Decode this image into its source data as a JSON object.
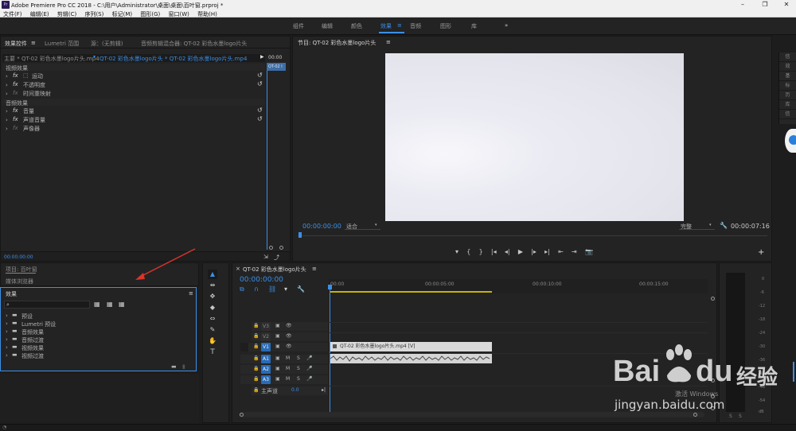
{
  "window": {
    "title": "Adobe Premiere Pro CC 2018 - C:\\用户\\Administrator\\桌面\\桌面\\百叶窗.prproj *",
    "logo": "Pr",
    "controls": [
      "–",
      "❐",
      "✕"
    ]
  },
  "menu": [
    "文件(F)",
    "编辑(E)",
    "剪辑(C)",
    "序列(S)",
    "标记(M)",
    "图形(G)",
    "窗口(W)",
    "帮助(H)"
  ],
  "workspaces": {
    "items": [
      "组件",
      "编辑",
      "颜色",
      "效果",
      "音频",
      "图形",
      "库"
    ],
    "active": "效果",
    "active_menu": "≡",
    "overflow": "»"
  },
  "effect_controls": {
    "tabs": [
      "效果控件",
      "Lumetri 范围",
      "源：(无剪辑)",
      "音频剪辑混合器: QT-02 彩色水墨logo片头"
    ],
    "tab_menu": "≡",
    "master_label": "主要 * QT-02 彩色水墨logo片头.mp4",
    "sequence_label": "QT-02 彩色水墨logo片头 * QT-02 彩色水墨logo片头.mp4",
    "timecode_mini": "00:00",
    "clip_mini": "QT-02 l",
    "video_section": "视频效果",
    "video_effects": [
      "运动",
      "不透明度",
      "时间重映射"
    ],
    "audio_section": "音频效果",
    "audio_effects": [
      "音量",
      "声道音量",
      "声像器"
    ],
    "timecode": "00:00:00:00",
    "reset_icon": "↺",
    "fx": "fx"
  },
  "program_monitor": {
    "title": "节目: QT-02 彩色水墨logo片头",
    "tab_menu": "≡",
    "timecode": "00:00:00:00",
    "fit": "适合",
    "quality": "完整",
    "duration": "00:00:07:16",
    "controls": [
      "▾",
      "{",
      "}",
      "|◂",
      "◂|",
      "▶",
      "|▸",
      "▸|",
      "⇤",
      "⇥",
      "📷"
    ],
    "add": "+"
  },
  "project": {
    "title": "项目: 百叶窗",
    "media_browser": "媒体浏览器"
  },
  "effects_panel": {
    "title": "效果",
    "tab_menu": "≡",
    "search_icon": "⌕",
    "folders": [
      "预设",
      "Lumetri 预设",
      "音频效果",
      "音频过渡",
      "视频效果",
      "视频过渡"
    ]
  },
  "tools": [
    "▲",
    "⇹",
    "✥",
    "◆",
    "⇔",
    "✎",
    "✋",
    "T"
  ],
  "timeline": {
    "close": "×",
    "sequence_name": "QT-02 彩色水墨logo片头",
    "tab_menu": "≡",
    "timecode": "00:00:00:00",
    "ruler": [
      "00:00",
      "00:00:05:00",
      "00:00:10:00",
      "00:00:15:00"
    ],
    "video_tracks": [
      "V3",
      "V2",
      "V1"
    ],
    "audio_tracks": [
      "A1",
      "A2",
      "A3"
    ],
    "master_track": "主声道",
    "master_value": "0.0",
    "clip_label": "QT-02 彩色水墨logo片头.mp4 [V]",
    "track_buttons": {
      "lock": "🔒",
      "m": "M",
      "s": "S",
      "eye": "👁",
      "mic": "🎤"
    }
  },
  "audio_meter": {
    "labels": [
      "0",
      "-6",
      "-12",
      "-18",
      "-24",
      "-30",
      "-36",
      "-42",
      "-48",
      "-54",
      "dB"
    ],
    "channels": [
      "S",
      "S"
    ]
  },
  "side_panel": [
    "信",
    "效",
    "基",
    "标",
    "历",
    "库",
    "信"
  ],
  "watermark": {
    "brand": "Bai",
    "brand2": "du",
    "site": "经验",
    "url": "jingyan.baidu.com",
    "activate": "激活 Windows"
  }
}
